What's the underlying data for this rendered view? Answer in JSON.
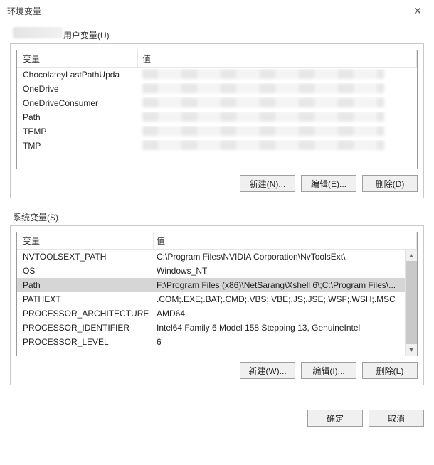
{
  "window": {
    "title": "环境变量",
    "close_icon_glyph": "✕"
  },
  "user_section": {
    "title_suffix": "用户变量(U)",
    "header": {
      "col1": "变量",
      "col2": "值"
    },
    "rows": [
      {
        "name": "ChocolateyLastPathUpda",
        "value_redacted": true
      },
      {
        "name": "OneDrive",
        "value_redacted": true
      },
      {
        "name": "OneDriveConsumer",
        "value_redacted": true
      },
      {
        "name": "Path",
        "value_redacted": true
      },
      {
        "name": "TEMP",
        "value_redacted": true
      },
      {
        "name": "TMP",
        "value_redacted": true
      }
    ],
    "buttons": {
      "new": "新建(N)...",
      "edit": "编辑(E)...",
      "del": "删除(D)"
    }
  },
  "system_section": {
    "title": "系统变量(S)",
    "header": {
      "col1": "变量",
      "col2": "值"
    },
    "rows": [
      {
        "name": "NVTOOLSEXT_PATH",
        "value": "C:\\Program Files\\NVIDIA Corporation\\NvToolsExt\\"
      },
      {
        "name": "OS",
        "value": "Windows_NT"
      },
      {
        "name": "Path",
        "value": "F:\\Program Files (x86)\\NetSarang\\Xshell 6\\;C:\\Program Files\\...",
        "selected": true
      },
      {
        "name": "PATHEXT",
        "value": ".COM;.EXE;.BAT;.CMD;.VBS;.VBE;.JS;.JSE;.WSF;.WSH;.MSC"
      },
      {
        "name": "PROCESSOR_ARCHITECTURE",
        "value": "AMD64"
      },
      {
        "name": "PROCESSOR_IDENTIFIER",
        "value": "Intel64 Family 6 Model 158 Stepping 13, GenuineIntel"
      },
      {
        "name": "PROCESSOR_LEVEL",
        "value": "6"
      }
    ],
    "buttons": {
      "new": "新建(W)...",
      "edit": "编辑(I)...",
      "del": "删除(L)"
    }
  },
  "dialog_buttons": {
    "ok": "确定",
    "cancel": "取消"
  }
}
